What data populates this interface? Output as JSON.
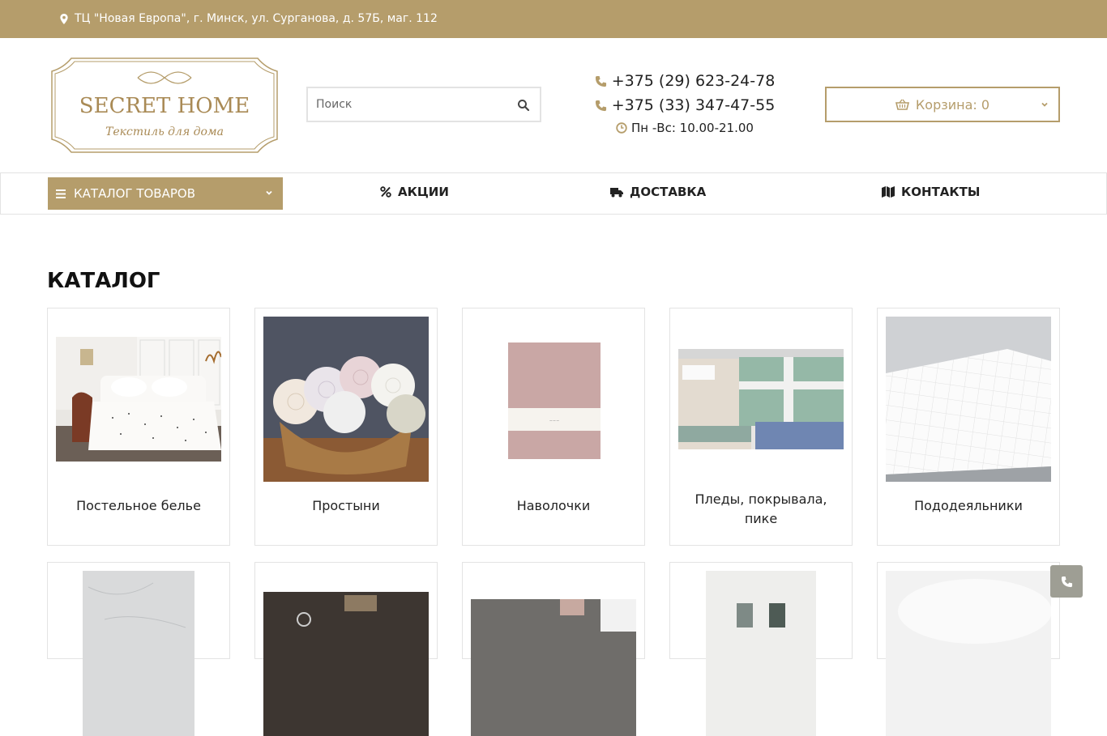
{
  "topbar": {
    "address": "ТЦ \"Новая Европа\", г. Минск, ул. Сурганова, д. 57Б, маг. 112"
  },
  "header": {
    "logo_title": "SECRET HOME",
    "logo_subtitle": "Текстиль для дома",
    "search_placeholder": "Поиск",
    "phone1": "+375 (29) 623-24-78",
    "phone2": "+375 (33) 347-47-55",
    "hours": "Пн -Вс: 10.00-21.00",
    "cart_label": "Корзина: 0"
  },
  "nav": {
    "catalog_button": "КАТАЛОГ ТОВАРОВ",
    "items": [
      {
        "label": "АКЦИИ",
        "icon": "percent-icon"
      },
      {
        "label": "ДОСТАВКА",
        "icon": "truck-icon"
      },
      {
        "label": "КОНТАКТЫ",
        "icon": "map-icon"
      }
    ]
  },
  "main": {
    "title": "КАТАЛОГ",
    "categories": [
      {
        "label": "Постельное белье"
      },
      {
        "label": "Простыни"
      },
      {
        "label": "Наволочки"
      },
      {
        "label": "Пледы, покрывала, пике"
      },
      {
        "label": "Пододеяльники"
      }
    ]
  },
  "colors": {
    "accent": "#b59d6b",
    "border": "#e3e3e3",
    "fab": "#9e9e94"
  }
}
